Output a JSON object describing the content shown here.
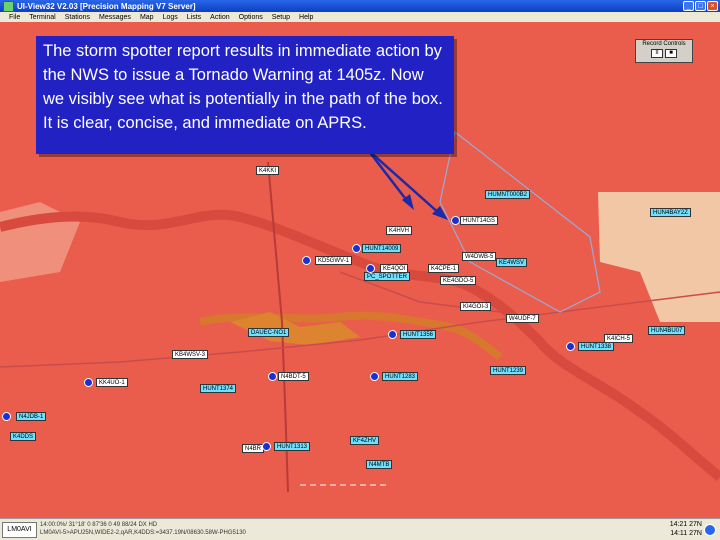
{
  "window": {
    "title": "UI-View32 V2.03 [Precision Mapping V7 Server]",
    "minimize": "_",
    "maximize": "□",
    "close": "×"
  },
  "menu": [
    "File",
    "Terminal",
    "Stations",
    "Messages",
    "Map",
    "Logs",
    "Lists",
    "Action",
    "Options",
    "Setup",
    "Help"
  ],
  "callout": {
    "text": "The storm spotter report results in immediate action by the NWS to issue a Tornado Warning at 1405z. Now we visibly see what is potentially in the path of the box. It is clear, concise, and immediate on APRS."
  },
  "record_controls": {
    "label": "Record Controls",
    "pause": "II",
    "stop": "■"
  },
  "stations": {
    "s1": "K4KKI",
    "s2": "HUMNT000B2",
    "s3": "HUNT14GS",
    "s4": "HUN4BAY2Z",
    "s5": "K4HVH",
    "s6": "HUNT14009",
    "s7": "KD5GWV-1",
    "s8": "KE4QOI",
    "s9": "K4CPE-1",
    "s10": "KE4WSV",
    "s11": "W4DWB-5",
    "s12": "KE4GDO-5",
    "s13": "W4UDF-7",
    "s14": "KI4GOI-3",
    "s15": "HUN4BU07",
    "s16": "DAUEC-NO1",
    "s17": "HUNT1356",
    "s18": "K4ICH-5",
    "s19": "HUNT1338",
    "s20": "KB4WSV-3",
    "s21": "KK4UO-1",
    "s22": "N4BDT-5",
    "s23": "HUNT1283",
    "s24": "HUNT1239",
    "s25": "N4JDB-1",
    "s26": "K4DDS",
    "s27": "N4BR",
    "s28": "HUNT1313",
    "s29": "KF4ZHV",
    "s30": "N4MTB",
    "s31": "HUNT1374",
    "s32": "PC_SPOTTER"
  },
  "status": {
    "callsign": "LM0AVI",
    "line1": "14:00:0%/ 31°18' 0 87'36 0 49 88/24 DX HD",
    "line2": "LM0AVI-5>APU25N,WIDE2-2,qAR,K4DDS:=3437.19N/08630.58W-PHG5130",
    "time": "14:21 27N",
    "date": "14:11 27N"
  }
}
